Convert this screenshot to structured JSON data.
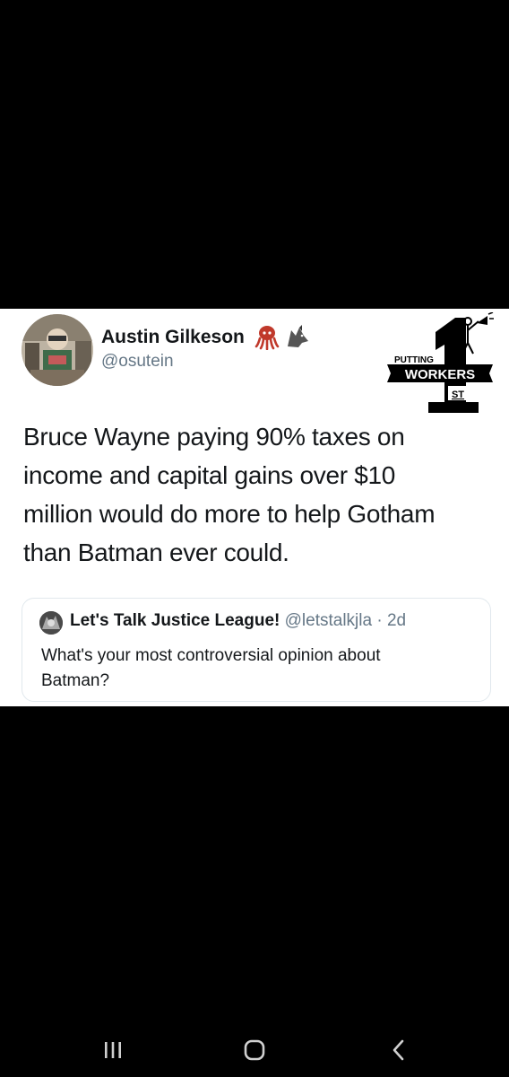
{
  "tweet": {
    "author": {
      "display_name": "Austin Gilkeson",
      "handle": "@osutein",
      "emoji_icons": [
        "octopus-icon",
        "wolf-icon"
      ]
    },
    "body_lines": [
      "Bruce Wayne paying 90% taxes on",
      "income and capital gains over $10",
      "million would do more to help Gotham",
      "than Batman ever could."
    ]
  },
  "quoted_tweet": {
    "name": "Let's Talk Justice League!",
    "handle_time": "@letstalkjla · 2d",
    "text_lines": [
      "What's your most controversial opinion about",
      "Batman?"
    ]
  },
  "logo": {
    "line1": "PUTTING",
    "line2": "WORKERS",
    "line3": "ST",
    "numeral": "1"
  },
  "system_nav": {
    "icons": [
      "recent-apps-icon",
      "home-icon",
      "back-icon"
    ]
  },
  "colors": {
    "text": "#14171a",
    "secondary": "#657786",
    "octopus": "#c0392b",
    "border": "#e1e8ed"
  }
}
